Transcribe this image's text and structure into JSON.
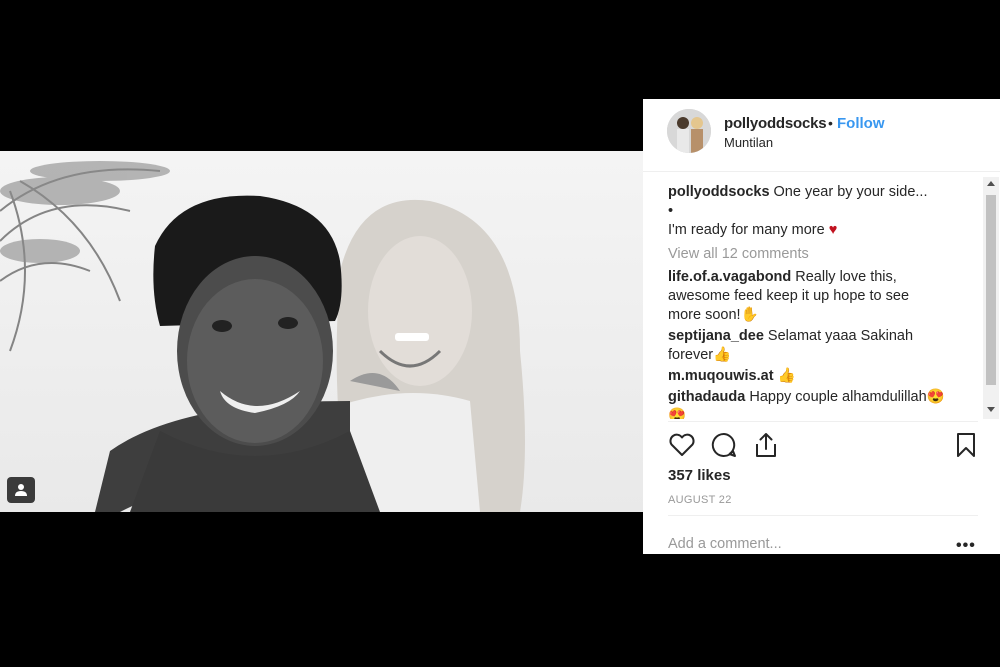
{
  "post": {
    "username": "pollyoddsocks",
    "separator": "•",
    "follow_label": "Follow",
    "location": "Muntilan"
  },
  "caption": {
    "username": "pollyoddsocks",
    "line1": "One year by your side...",
    "line2": "•",
    "line3": "I'm ready for many more",
    "emoji": "♥"
  },
  "view_all": "View all 12 comments",
  "comments": [
    {
      "user": "life.of.a.vagabond",
      "text": "Really love this, awesome feed keep it up hope to see more soon!",
      "emoji": "✋"
    },
    {
      "user": "septijana_dee",
      "text": "Selamat yaaa Sakinah forever",
      "emoji": "👍"
    },
    {
      "user": "m.muqouwis.at",
      "text": "",
      "emoji": "👍"
    },
    {
      "user": "githadauda",
      "text": "Happy couple alhamdulillah",
      "emoji": "😍😍"
    }
  ],
  "likes": "357 likes",
  "date": "AUGUST 22",
  "add_comment_placeholder": "Add a comment...",
  "more_label": "•••",
  "colors": {
    "accent": "#3897f0",
    "text": "#262626",
    "muted": "#999999",
    "heart": "#ed4956"
  }
}
